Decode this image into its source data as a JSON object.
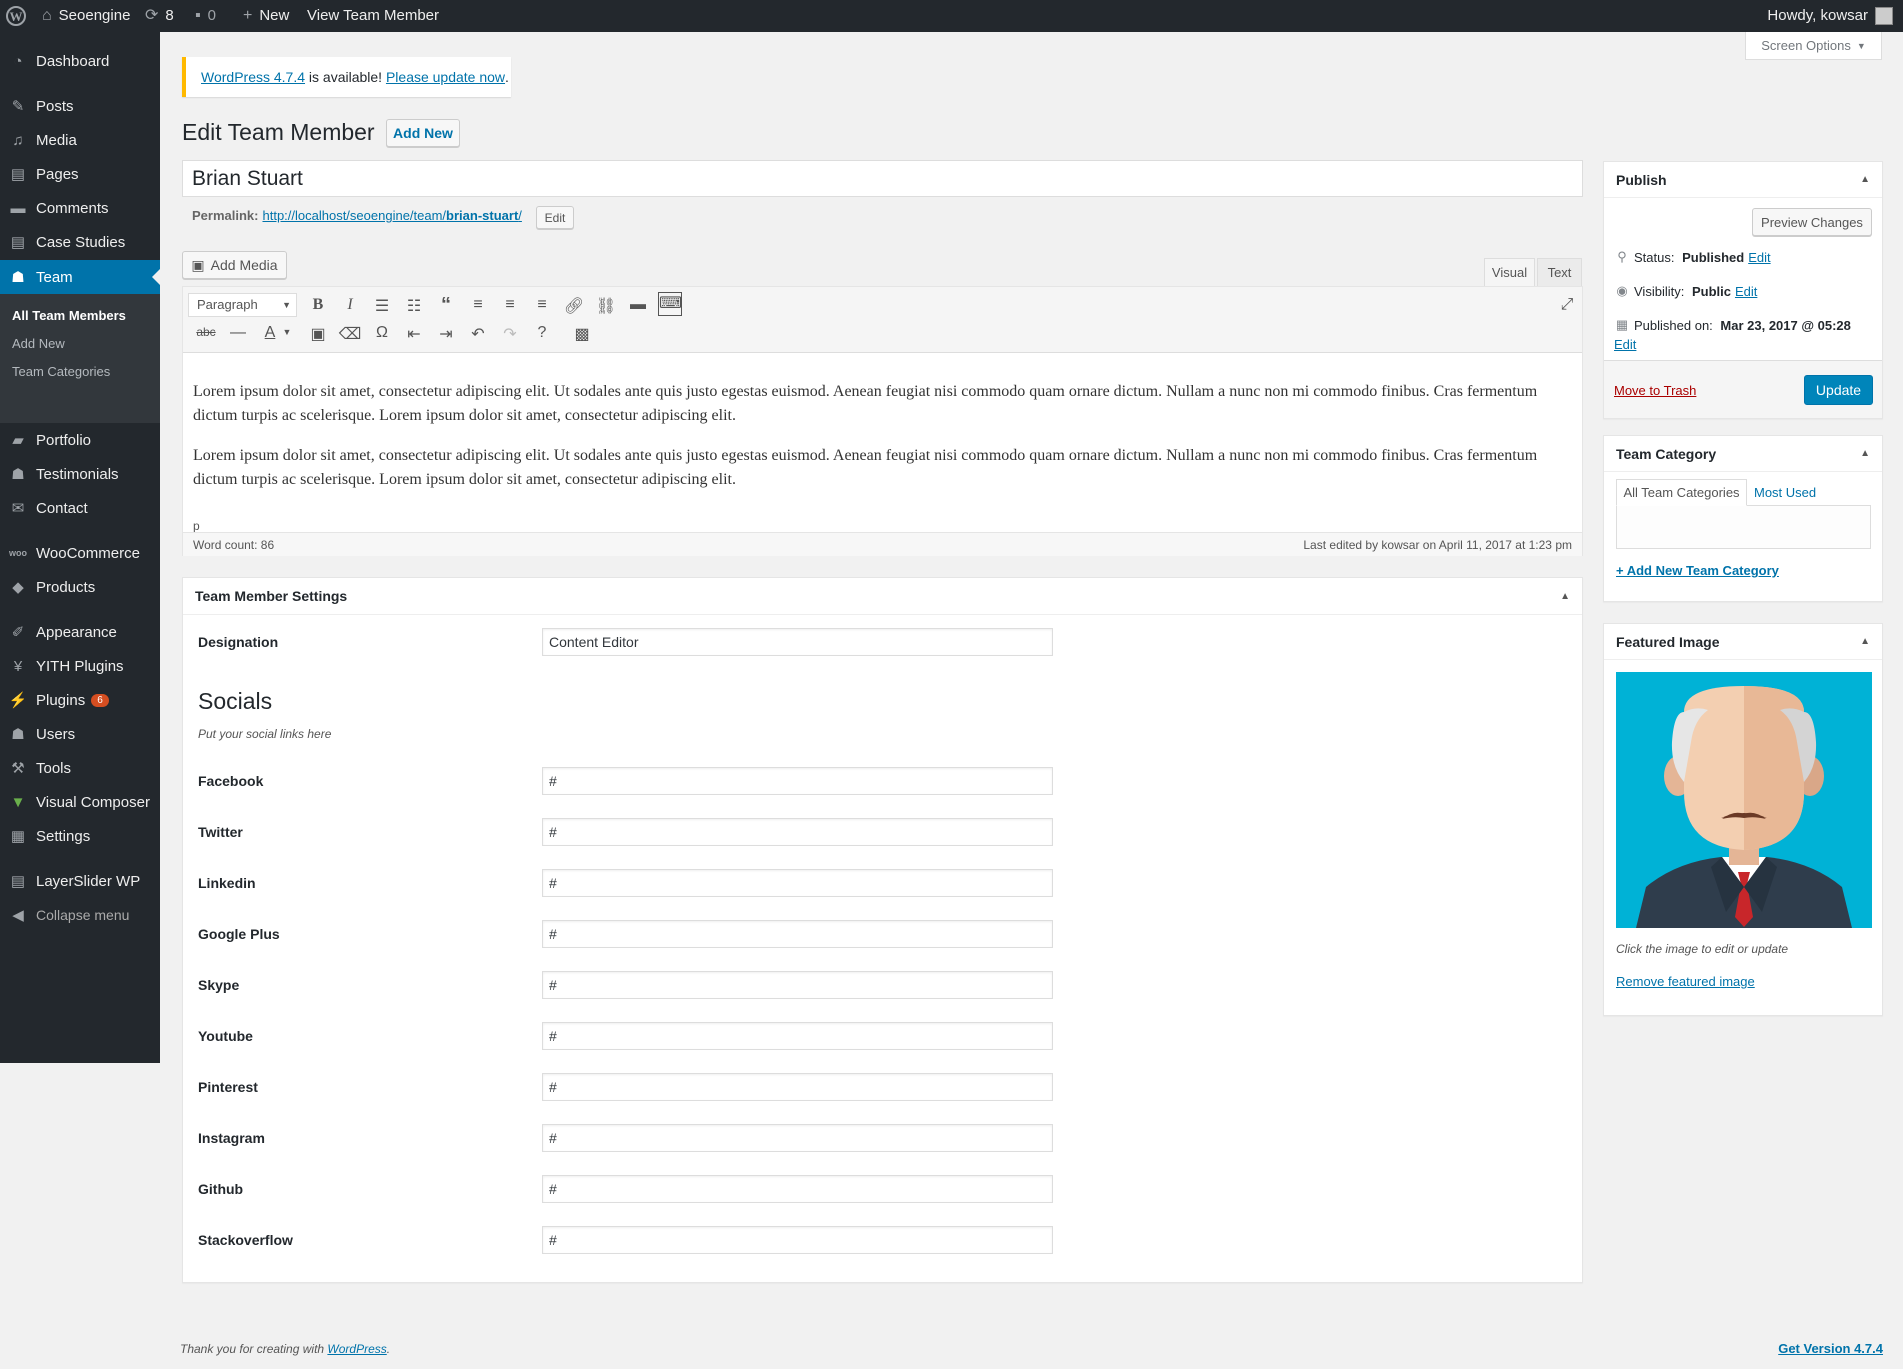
{
  "adminbar": {
    "site_name": "Seoengine",
    "updates_count": "8",
    "comments_count": "0",
    "new_label": "New",
    "view_label": "View Team Member",
    "howdy": "Howdy, kowsar"
  },
  "screen_options": "Screen Options",
  "sidebar": {
    "items": [
      {
        "label": "Dashboard",
        "icon": "dashboard-icon"
      },
      {
        "label": "Posts",
        "icon": "pin-icon"
      },
      {
        "label": "Media",
        "icon": "media-icon"
      },
      {
        "label": "Pages",
        "icon": "pages-icon"
      },
      {
        "label": "Comments",
        "icon": "comment-icon"
      },
      {
        "label": "Case Studies",
        "icon": "pages-icon"
      },
      {
        "label": "Team",
        "icon": "user-icon"
      },
      {
        "label": "Portfolio",
        "icon": "folder-icon"
      },
      {
        "label": "Testimonials",
        "icon": "users-icon"
      },
      {
        "label": "Contact",
        "icon": "mail-icon"
      },
      {
        "label": "WooCommerce",
        "icon": "woo-icon"
      },
      {
        "label": "Products",
        "icon": "cube-icon"
      },
      {
        "label": "Appearance",
        "icon": "brush-icon"
      },
      {
        "label": "YITH Plugins",
        "icon": "yith-icon"
      },
      {
        "label": "Plugins",
        "icon": "plug-icon",
        "badge": "6"
      },
      {
        "label": "Users",
        "icon": "user-icon"
      },
      {
        "label": "Tools",
        "icon": "wrench-icon"
      },
      {
        "label": "Visual Composer",
        "icon": "vc-icon"
      },
      {
        "label": "Settings",
        "icon": "settings-icon"
      },
      {
        "label": "LayerSlider WP",
        "icon": "layers-icon"
      },
      {
        "label": "Collapse menu",
        "icon": "collapse-icon"
      }
    ],
    "submenu": [
      "All Team Members",
      "Add New",
      "Team Categories"
    ]
  },
  "notice": {
    "link1": "WordPress 4.7.4",
    "text": " is available! ",
    "link2": "Please update now",
    "end": "."
  },
  "page": {
    "heading": "Edit Team Member",
    "add_new": "Add New",
    "title_value": "Brian Stuart",
    "permalink_label": "Permalink:",
    "permalink_base": "http://localhost/seoengine/team/",
    "permalink_slug": "brian-stuart",
    "permalink_end": "/",
    "permalink_edit": "Edit"
  },
  "editor": {
    "add_media": "Add Media",
    "tab_visual": "Visual",
    "tab_text": "Text",
    "format_select": "Paragraph",
    "path": "p",
    "word_count": "Word count: 86",
    "last_edited": "Last edited by kowsar on April 11, 2017 at 1:23 pm",
    "paragraph": "Lorem ipsum dolor sit amet, consectetur adipiscing elit. Ut sodales ante quis justo egestas euismod. Aenean feugiat nisi commodo quam ornare dictum. Nullam a nunc non mi commodo finibus. Cras fermentum dictum turpis ac scelerisque. Lorem ipsum dolor sit amet, consectetur adipiscing elit."
  },
  "settings": {
    "title": "Team Member Settings",
    "designation_label": "Designation",
    "designation_value": "Content Editor",
    "socials_title": "Socials",
    "socials_desc": "Put your social links here",
    "socials": [
      {
        "label": "Facebook",
        "value": "#"
      },
      {
        "label": "Twitter",
        "value": "#"
      },
      {
        "label": "Linkedin",
        "value": "#"
      },
      {
        "label": "Google Plus",
        "value": "#"
      },
      {
        "label": "Skype",
        "value": "#"
      },
      {
        "label": "Youtube",
        "value": "#"
      },
      {
        "label": "Pinterest",
        "value": "#"
      },
      {
        "label": "Instagram",
        "value": "#"
      },
      {
        "label": "Github",
        "value": "#"
      },
      {
        "label": "Stackoverflow",
        "value": "#"
      }
    ]
  },
  "publish": {
    "title": "Publish",
    "preview": "Preview Changes",
    "status_label": "Status: ",
    "status_value": "Published",
    "visibility_label": "Visibility: ",
    "visibility_value": "Public",
    "published_label": "Published on: ",
    "published_value": "Mar 23, 2017 @ 05:28",
    "edit": "Edit",
    "trash": "Move to Trash",
    "update": "Update"
  },
  "team_category": {
    "title": "Team Category",
    "tab_all": "All Team Categories",
    "tab_used": "Most Used",
    "add_new": "+ Add New Team Category"
  },
  "featured": {
    "title": "Featured Image",
    "caption": "Click the image to edit or update",
    "remove": "Remove featured image"
  },
  "footer": {
    "thanks": "Thank you for creating with ",
    "wp_link": "WordPress",
    "thanks_end": ".",
    "version": "Get Version 4.7.4"
  },
  "colors": {
    "adminbar": "#23282d",
    "accent": "#0073aa",
    "trash": "#a00",
    "badge": "#d54e21",
    "image_bg": "#00b2d6"
  }
}
